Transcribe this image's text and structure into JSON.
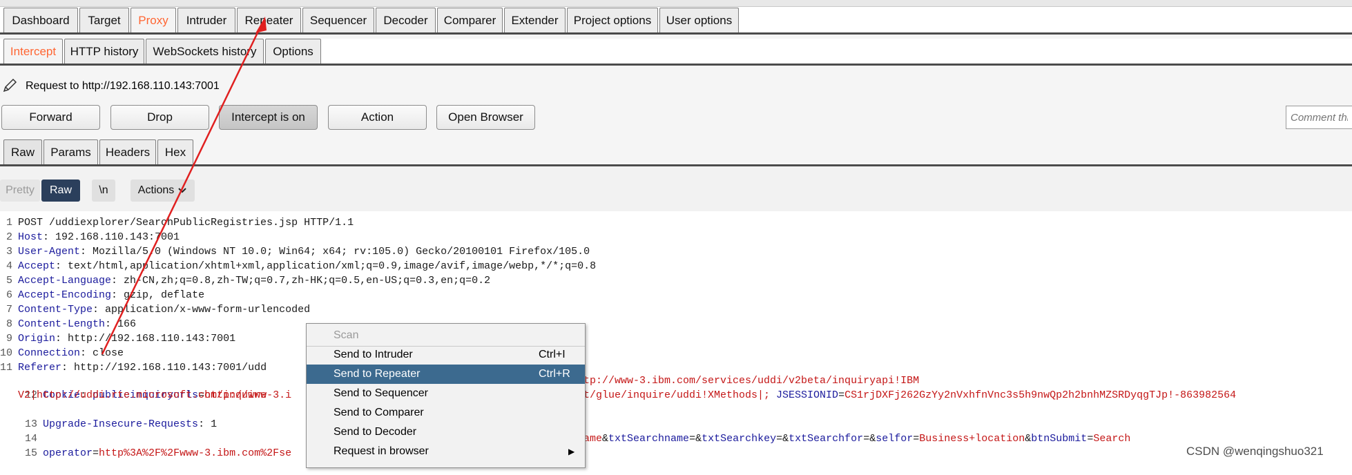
{
  "main_tabs": [
    "Dashboard",
    "Target",
    "Proxy",
    "Intruder",
    "Repeater",
    "Sequencer",
    "Decoder",
    "Comparer",
    "Extender",
    "Project options",
    "User options"
  ],
  "proxy_tabs": [
    "Intercept",
    "HTTP history",
    "WebSockets history",
    "Options"
  ],
  "request_label": "Request to http://192.168.110.143:7001",
  "toolbar": {
    "forward": "Forward",
    "drop": "Drop",
    "intercept": "Intercept is on",
    "action": "Action",
    "open_browser": "Open Browser",
    "comment_placeholder": "Comment this item"
  },
  "message_tabs": [
    "Raw",
    "Params",
    "Headers",
    "Hex"
  ],
  "editor_toolbar": {
    "pretty": "Pretty",
    "raw": "Raw",
    "newline": "\\n",
    "actions": "Actions"
  },
  "request_lines": [
    {
      "n": "1",
      "name": "",
      "sep": "",
      "value": "POST /uddiexplorer/SearchPublicRegistries.jsp HTTP/1.1"
    },
    {
      "n": "2",
      "name": "Host",
      "sep": ": ",
      "value": "192.168.110.143:7001"
    },
    {
      "n": "3",
      "name": "User-Agent",
      "sep": ": ",
      "value": "Mozilla/5.0 (Windows NT 10.0; Win64; x64; rv:105.0) Gecko/20100101 Firefox/105.0"
    },
    {
      "n": "4",
      "name": "Accept",
      "sep": ": ",
      "value": "text/html,application/xhtml+xml,application/xml;q=0.9,image/avif,image/webp,*/*;q=0.8"
    },
    {
      "n": "5",
      "name": "Accept-Language",
      "sep": ": ",
      "value": "zh-CN,zh;q=0.8,zh-TW;q=0.7,zh-HK;q=0.5,en-US;q=0.3,en;q=0.2"
    },
    {
      "n": "6",
      "name": "Accept-Encoding",
      "sep": ": ",
      "value": "gzip, deflate"
    },
    {
      "n": "7",
      "name": "Content-Type",
      "sep": ": ",
      "value": "application/x-www-form-urlencoded"
    },
    {
      "n": "8",
      "name": "Content-Length",
      "sep": ": ",
      "value": "166"
    },
    {
      "n": "9",
      "name": "Origin",
      "sep": ": ",
      "value": "http://192.168.110.143:7001"
    },
    {
      "n": "10",
      "name": "Connection",
      "sep": ": ",
      "value": "close"
    },
    {
      "n": "11",
      "name": "Referer",
      "sep": ": ",
      "value": "http://192.168.110.143:7001/udd"
    }
  ],
  "cookie_line": {
    "n": "12",
    "name": "Cookie",
    "sep": ": ",
    "p1_name": "publicinquiryurls",
    "p1_eq": "=",
    "p1_val": "http://www-3.i",
    "p1_tail": "tp://www-3.ibm.com/services/uddi/v2beta/inquiryapi!IBM",
    "cont_head": "V2|http://uddi.rte.microsoft.com/inquire",
    "cont_tail": "t/glue/inquire/uddi!XMethods|; ",
    "jsession_name": "JSESSIONID",
    "jsession_eq": "=",
    "jsession_val": "CS1rjDXFj262GzYy2nVxhfnVnc3s5h9nwQp2h2bnhMZSRDyqgTJp!-863982564"
  },
  "line13": {
    "n": "13",
    "name": "Upgrade-Insecure-Requests",
    "sep": ": ",
    "value": "1"
  },
  "line14": {
    "n": "14"
  },
  "body_line": {
    "n": "15",
    "head_name": "operator",
    "head_eq": "=",
    "head_val": "http%3A%2F%2Fwww-3.ibm.com%2Fse",
    "tail": [
      {
        "t": "v",
        "s": "ame"
      },
      {
        "t": "s",
        "s": "&"
      },
      {
        "t": "n",
        "s": "txtSearchname"
      },
      {
        "t": "s",
        "s": "="
      },
      {
        "t": "s",
        "s": "&"
      },
      {
        "t": "n",
        "s": "txtSearchkey"
      },
      {
        "t": "s",
        "s": "="
      },
      {
        "t": "s",
        "s": "&"
      },
      {
        "t": "n",
        "s": "txtSearchfor"
      },
      {
        "t": "s",
        "s": "="
      },
      {
        "t": "s",
        "s": "&"
      },
      {
        "t": "n",
        "s": "selfor"
      },
      {
        "t": "s",
        "s": "="
      },
      {
        "t": "v",
        "s": "Business+location"
      },
      {
        "t": "s",
        "s": "&"
      },
      {
        "t": "n",
        "s": "btnSubmit"
      },
      {
        "t": "s",
        "s": "="
      },
      {
        "t": "v",
        "s": "Search"
      }
    ]
  },
  "context_menu": [
    {
      "label": "Scan",
      "shortcut": "",
      "state": "disabled"
    },
    {
      "label": "Send to Intruder",
      "shortcut": "Ctrl+I",
      "state": "normal"
    },
    {
      "label": "Send to Repeater",
      "shortcut": "Ctrl+R",
      "state": "selected"
    },
    {
      "label": "Send to Sequencer",
      "shortcut": "",
      "state": "normal"
    },
    {
      "label": "Send to Comparer",
      "shortcut": "",
      "state": "normal"
    },
    {
      "label": "Send to Decoder",
      "shortcut": "",
      "state": "normal"
    },
    {
      "label": "Request in browser",
      "shortcut": "",
      "state": "submenu"
    }
  ],
  "watermark": "CSDN @wenqingshuo321",
  "colors": {
    "active_tab": "#ff6633",
    "menu_selected": "#3c6a8f",
    "header_name": "#1a1a9c",
    "param_value": "#c41616",
    "annotation_arrow": "#e02020"
  }
}
